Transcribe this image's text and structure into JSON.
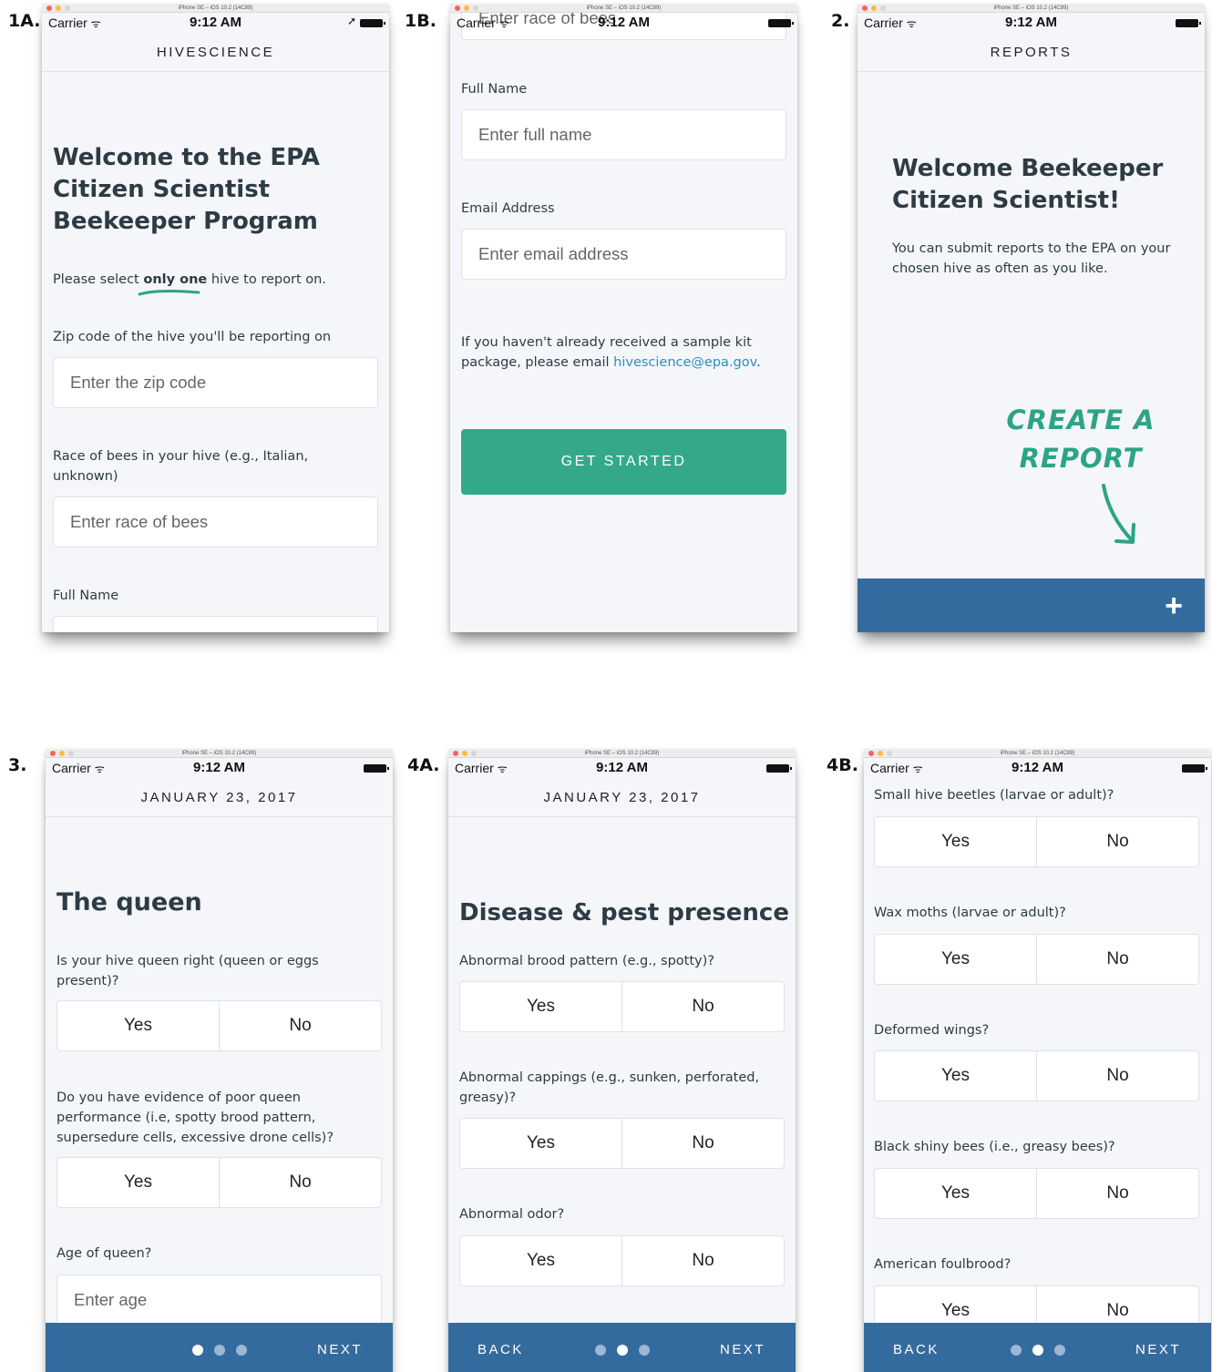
{
  "simulator": {
    "title": "iPhone SE – iOS 10.2 (14C89)"
  },
  "status": {
    "carrier": "Carrier",
    "wifi": "ᯤ",
    "time": "9:12 AM",
    "location_arrow": "➚"
  },
  "panels": {
    "p1a": {
      "label": "1A.",
      "nav_title": "HIVESCIENCE",
      "heading_lines": [
        "Welcome to the EPA",
        "Citizen Scientist",
        "Beekeeper Program"
      ],
      "instruction_pre": "Please select ",
      "instruction_emph": "only one",
      "instruction_post": " hive to report on.",
      "zip_label": "Zip code of the hive you'll be reporting on",
      "zip_placeholder": "Enter the zip code",
      "race_label_lines": [
        "Race of bees in your hive (e.g., Italian,",
        "unknown)"
      ],
      "race_placeholder": "Enter race of bees",
      "name_label": "Full Name"
    },
    "p1b": {
      "label": "1B.",
      "scrolled_placeholder": "Enter race of bees",
      "name_label": "Full Name",
      "name_placeholder": "Enter full name",
      "email_label": "Email Address",
      "email_placeholder": "Enter email address",
      "kit_line1": "If you haven't already received a sample kit",
      "kit_line2_pre": "package, please email ",
      "kit_email": "hivescience@epa.gov",
      "kit_line2_post": ".",
      "button": "GET STARTED"
    },
    "p2": {
      "label": "2.",
      "nav_title": "REPORTS",
      "heading_lines": [
        "Welcome Beekeeper",
        "Citizen Scientist!"
      ],
      "body_lines": [
        "You can submit reports to the EPA on your",
        "chosen hive as often as you like."
      ],
      "callout_lines": [
        "CREATE A",
        "REPORT"
      ],
      "add_button": "+"
    },
    "p3": {
      "label": "3.",
      "nav_title": "JANUARY 23, 2017",
      "heading": "The queen",
      "q1_lines": [
        "Is your hive queen right (queen or eggs",
        "present)?"
      ],
      "q2_lines": [
        "Do you have evidence of poor queen",
        "performance (i.e, spotty brood pattern,",
        "supersedure cells, excessive drone cells)?"
      ],
      "q3": "Age of queen?",
      "age_placeholder": "Enter age",
      "yes": "Yes",
      "no": "No",
      "next": "NEXT",
      "active_page": 1,
      "page_count": 3
    },
    "p4a": {
      "label": "4A.",
      "nav_title": "JANUARY 23, 2017",
      "heading": "Disease & pest presence",
      "q1": "Abnormal brood pattern (e.g., spotty)?",
      "q2_lines": [
        "Abnormal cappings (e.g., sunken, perforated,",
        "greasy)?"
      ],
      "q3": "Abnormal odor?",
      "yes": "Yes",
      "no": "No",
      "back": "BACK",
      "next": "NEXT",
      "active_page": 2,
      "page_count": 3
    },
    "p4b": {
      "label": "4B.",
      "q1": "Small hive beetles (larvae or adult)?",
      "q2": "Wax moths (larvae or adult)?",
      "q3": "Deformed wings?",
      "q4": "Black shiny bees (i.e., greasy bees)?",
      "q5": "American foulbrood?",
      "yes": "Yes",
      "no": "No",
      "back": "BACK",
      "next": "NEXT",
      "active_page": 2,
      "page_count": 3
    }
  },
  "colors": {
    "primary_blue": "#346b9e",
    "accent_green": "#33a98a",
    "link_blue": "#2f8fb8",
    "screen_bg": "#f5f6f9"
  }
}
